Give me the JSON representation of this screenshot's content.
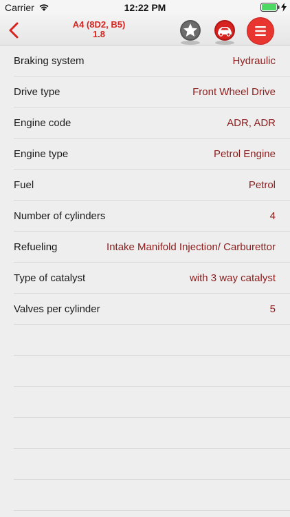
{
  "status_bar": {
    "carrier": "Carrier",
    "time": "12:22 PM"
  },
  "nav": {
    "title_line1": "A4 (8D2, B5)",
    "title_line2": "1.8",
    "accent_color": "#d7231f"
  },
  "specs": [
    {
      "label": "Braking system",
      "value": "Hydraulic"
    },
    {
      "label": "Drive type",
      "value": "Front Wheel Drive"
    },
    {
      "label": "Engine code",
      "value": "ADR, ADR"
    },
    {
      "label": "Engine type",
      "value": "Petrol Engine"
    },
    {
      "label": "Fuel",
      "value": "Petrol"
    },
    {
      "label": "Number of cylinders",
      "value": "4"
    },
    {
      "label": "Refueling",
      "value": "Intake Manifold Injection/ Carburettor"
    },
    {
      "label": "Type of catalyst",
      "value": "with 3 way catalyst"
    },
    {
      "label": "Valves per cylinder",
      "value": "5"
    }
  ],
  "icons": {
    "back": "chevron-left-icon",
    "favorite": "star-icon",
    "car": "car-icon",
    "menu": "hamburger-menu-icon",
    "wifi": "wifi-icon",
    "battery": "battery-icon"
  }
}
